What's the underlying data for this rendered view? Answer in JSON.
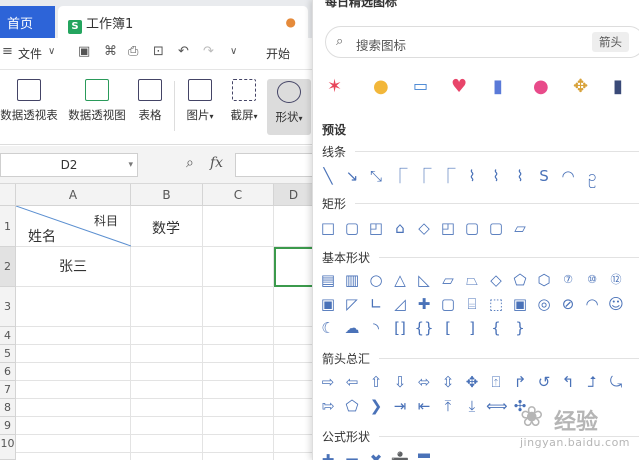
{
  "tabs": {
    "home": "首页",
    "workbook": "工作簿1"
  },
  "menu": {
    "file": "文件",
    "start": "开始"
  },
  "toolbar": {
    "items": [
      "数据透视表",
      "数据透视图",
      "表格",
      "图片",
      "截屏",
      "形状"
    ]
  },
  "formula": {
    "name_box": "D2",
    "fx": "fx"
  },
  "columns": [
    "A",
    "B",
    "C",
    "D"
  ],
  "rows": [
    "1",
    "2",
    "3",
    "4",
    "5",
    "6",
    "7",
    "8",
    "9",
    "10"
  ],
  "cells": {
    "a1_top": "科目",
    "a1_bottom": "姓名",
    "b1": "数学",
    "a2": "张三"
  },
  "panel": {
    "title": "每日精选图标",
    "search_placeholder": "搜索图标",
    "chip": "箭头",
    "featured_icons": [
      "firework-icon",
      "bulb-icon",
      "chart-icon",
      "heart-icon",
      "phone-icon",
      "lock-icon",
      "ornament-icon",
      "book-icon"
    ],
    "preset": "预设",
    "sections": {
      "lines": "线条",
      "rect": "矩形",
      "basic": "基本形状",
      "arrows": "箭头总汇",
      "formula": "公式形状"
    }
  },
  "watermark": {
    "text": "经验",
    "sub": "jingyan.baidu.com"
  },
  "colors": {
    "accent": "#2d64d8",
    "green": "#24a55f",
    "shape": "#4a72b8",
    "select": "#3b9a4c"
  }
}
